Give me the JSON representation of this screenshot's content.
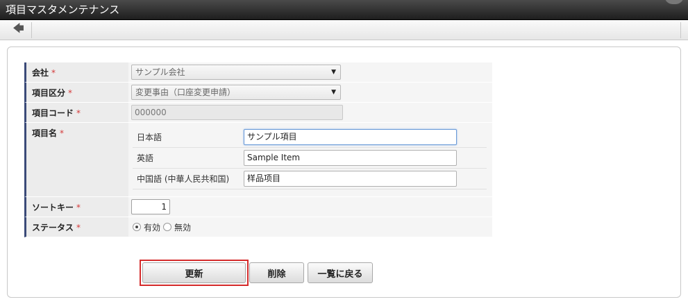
{
  "window": {
    "title": "項目マスタメンテナンス"
  },
  "toolbar": {
    "back_icon": "left-arrow-icon",
    "back_glyph": "🡄"
  },
  "form": {
    "company": {
      "label": "会社",
      "required_mark": "*",
      "value": "サンプル会社"
    },
    "category": {
      "label": "項目区分",
      "required_mark": "*",
      "value": "変更事由（口座変更申請）"
    },
    "code": {
      "label": "項目コード",
      "required_mark": "*",
      "value": "000000"
    },
    "name": {
      "label": "項目名",
      "required_mark": "*",
      "languages": [
        {
          "lang": "日本語",
          "value": "サンプル項目"
        },
        {
          "lang": "英語",
          "value": "Sample Item"
        },
        {
          "lang": "中国語 (中華人民共和国)",
          "value": "样品项目"
        }
      ]
    },
    "sort_key": {
      "label": "ソートキー",
      "required_mark": "*",
      "value": "1"
    },
    "status": {
      "label": "ステータス",
      "required_mark": "*",
      "options": [
        {
          "label": "有効",
          "checked": true
        },
        {
          "label": "無効",
          "checked": false
        }
      ]
    }
  },
  "actions": {
    "update_label": "更新",
    "delete_label": "削除",
    "back_label": "一覧に戻る"
  },
  "colors": {
    "required": "#d43a3a",
    "label_accent": "#3a4a78",
    "highlight": "#d42a2a"
  }
}
